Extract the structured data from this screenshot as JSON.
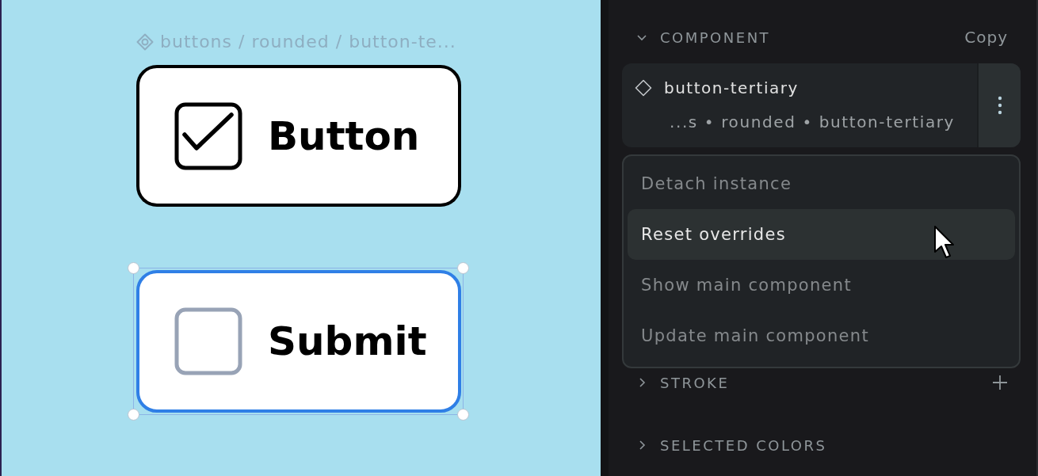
{
  "canvas": {
    "breadcrumb": "buttons / rounded / button-te...",
    "frames": [
      {
        "label": "Button",
        "checked": true,
        "selected": false
      },
      {
        "label": "Submit",
        "checked": false,
        "selected": true
      }
    ]
  },
  "panel": {
    "component": {
      "title": "COMPONENT",
      "expanded": true,
      "action": "Copy",
      "name": "button-tertiary",
      "path": "...s • rounded • button-tertiary",
      "menu": [
        {
          "label": "Detach instance",
          "hovered": false
        },
        {
          "label": "Reset overrides",
          "hovered": true
        },
        {
          "label": "Show main component",
          "hovered": false
        },
        {
          "label": "Update main component",
          "hovered": false
        }
      ]
    },
    "sections": [
      {
        "title": "STROKE",
        "expanded": false,
        "add": true
      },
      {
        "title": "SELECTED COLORS",
        "expanded": false,
        "add": false
      }
    ]
  }
}
